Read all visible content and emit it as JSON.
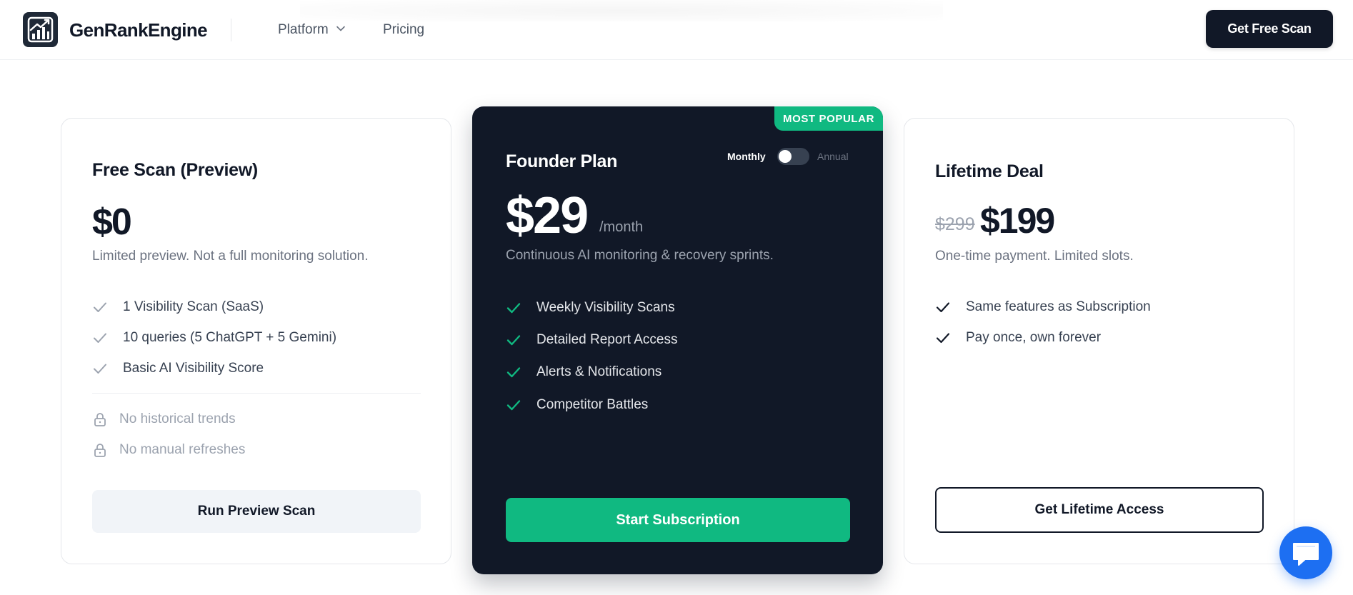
{
  "header": {
    "brand": "GenRankEngine",
    "nav": [
      {
        "label": "Platform",
        "has_dropdown": true
      },
      {
        "label": "Pricing",
        "has_dropdown": false
      }
    ],
    "cta_label": "Get Free Scan"
  },
  "plans": {
    "free": {
      "title": "Free Scan (Preview)",
      "price": "$0",
      "description": "Limited preview. Not a full monitoring solution.",
      "features": [
        "1 Visibility Scan (SaaS)",
        "10 queries (5 ChatGPT + 5 Gemini)",
        "Basic AI Visibility Score"
      ],
      "locked": [
        "No historical trends",
        "No manual refreshes"
      ],
      "button": "Run Preview Scan"
    },
    "founder": {
      "badge": "MOST POPULAR",
      "title": "Founder Plan",
      "toggle": {
        "left": "Monthly",
        "right": "Annual",
        "selected": "Monthly"
      },
      "price": "$29",
      "period": "/month",
      "description": "Continuous AI monitoring & recovery sprints.",
      "features": [
        "Weekly Visibility Scans",
        "Detailed Report Access",
        "Alerts & Notifications",
        "Competitor Battles"
      ],
      "button": "Start Subscription"
    },
    "lifetime": {
      "title": "Lifetime Deal",
      "old_price": "$299",
      "price": "$199",
      "description": "One-time payment. Limited slots.",
      "features": [
        "Same features as Subscription",
        "Pay once, own forever"
      ],
      "button": "Get Lifetime Access"
    }
  },
  "colors": {
    "dark": "#111827",
    "accent_green": "#10b981",
    "chat_blue": "#1d6ff2",
    "muted_text": "#6b7280"
  },
  "icons": {
    "logo": "chart-growth-icon",
    "check": "check-icon",
    "lock": "lock-icon",
    "chat": "chat-bubble-icon"
  }
}
